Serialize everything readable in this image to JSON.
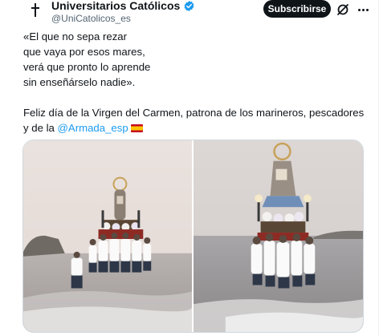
{
  "tweet": {
    "author": {
      "name": "Universitarios Católicos",
      "handle": "@UniCatolicos_es",
      "verified": true,
      "verified_color": "#1d9bf0"
    },
    "subscribe_label": "Subscribirse",
    "text_lines": [
      "«El que no sepa rezar",
      "que vaya por esos mares,",
      "verá que pronto lo aprende",
      "sin enseñárselo nadie».",
      "Feliz día de la Virgen del Carmen, patrona de los marineros, pescadores",
      "y de la"
    ],
    "mention": "@Armada_esp",
    "emoji": "spain-flag",
    "photos": [
      {
        "icon": "procession-photo-1"
      },
      {
        "icon": "procession-photo-2"
      }
    ],
    "colors": {
      "text": "#0f1419",
      "secondary": "#536471",
      "link": "#1d9bf0",
      "button_bg": "#0f1419"
    }
  }
}
